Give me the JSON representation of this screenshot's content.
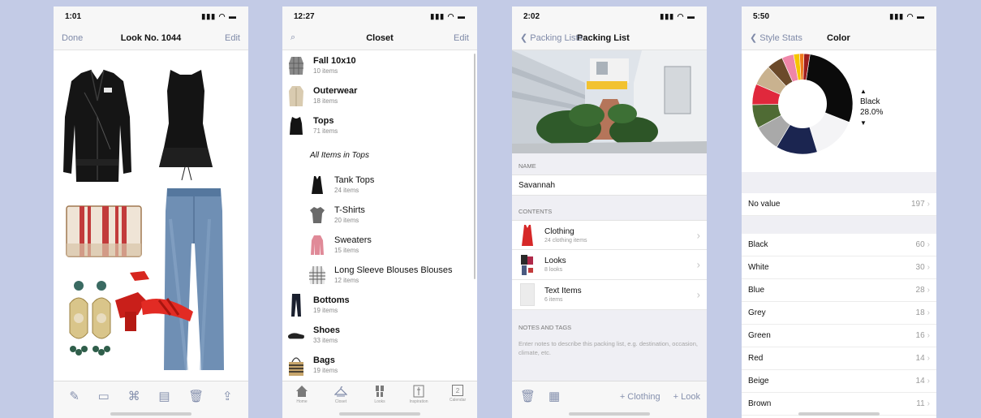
{
  "phone1": {
    "time": "1:01",
    "nav_left": "Done",
    "title": "Look No. 1044",
    "nav_right": "Edit",
    "toolbar_icons": [
      "edit-icon",
      "folder-icon",
      "outfit-icon",
      "calendar-icon",
      "trash-icon",
      "share-icon"
    ]
  },
  "phone2": {
    "time": "12:27",
    "title": "Closet",
    "nav_right": "Edit",
    "categories_top": [
      {
        "name": "Fall 10x10",
        "count": "10 items"
      },
      {
        "name": "Outerwear",
        "count": "18 items"
      },
      {
        "name": "Tops",
        "count": "71 items"
      }
    ],
    "section_label": "All Items in Tops",
    "subcategories": [
      {
        "name": "Tank Tops",
        "count": "24 items"
      },
      {
        "name": "T-Shirts",
        "count": "20 items"
      },
      {
        "name": "Sweaters",
        "count": "15 items"
      },
      {
        "name": "Long Sleeve Blouses Blouses",
        "count": "12 items"
      }
    ],
    "categories_bottom": [
      {
        "name": "Bottoms",
        "count": "19 items"
      },
      {
        "name": "Shoes",
        "count": "33 items"
      },
      {
        "name": "Bags",
        "count": "19 items"
      }
    ],
    "tabs": [
      "Home",
      "Closet",
      "Looks",
      "Inspiration",
      "Calendar"
    ],
    "calendar_day": "2"
  },
  "phone3": {
    "time": "2:02",
    "back_label": "Packing Lists",
    "title": "Packing List",
    "name_header": "NAME",
    "name_value": "Savannah",
    "contents_header": "CONTENTS",
    "contents": [
      {
        "title": "Clothing",
        "sub": "24 clothing items"
      },
      {
        "title": "Looks",
        "sub": "8 looks"
      },
      {
        "title": "Text Items",
        "sub": "6 items"
      }
    ],
    "notes_header": "NOTES AND TAGS",
    "notes_placeholder": "Enter notes to describe this packing list, e.g. destination, occasion, climate, etc.",
    "add_clothing": "+ Clothing",
    "add_look": "+ Look"
  },
  "phone4": {
    "time": "5:50",
    "back_label": "Style Stats",
    "title": "Color",
    "selected_color": "Black",
    "selected_pct": "28.0%",
    "no_value": {
      "label": "No value",
      "count": "197"
    },
    "colors": [
      {
        "label": "Black",
        "count": "60"
      },
      {
        "label": "White",
        "count": "30"
      },
      {
        "label": "Blue",
        "count": "28"
      },
      {
        "label": "Grey",
        "count": "18"
      },
      {
        "label": "Green",
        "count": "16"
      },
      {
        "label": "Red",
        "count": "14"
      },
      {
        "label": "Beige",
        "count": "14"
      },
      {
        "label": "Brown",
        "count": "11"
      }
    ],
    "donut_colors": {
      "Black": "#0b0b0b",
      "White": "#f4f4f6",
      "Blue": "#1b2550",
      "Grey": "#a9a9a9",
      "Green": "#4f6b34",
      "Red": "#e0283c",
      "Beige": "#c9b28f",
      "Brown": "#6b4a2a",
      "Pink": "#ef86a8",
      "Yellow": "#f6c500",
      "Orange": "#f07a1c",
      "DarkRed": "#9d1c1c"
    }
  },
  "accent": "#7f8aa8"
}
